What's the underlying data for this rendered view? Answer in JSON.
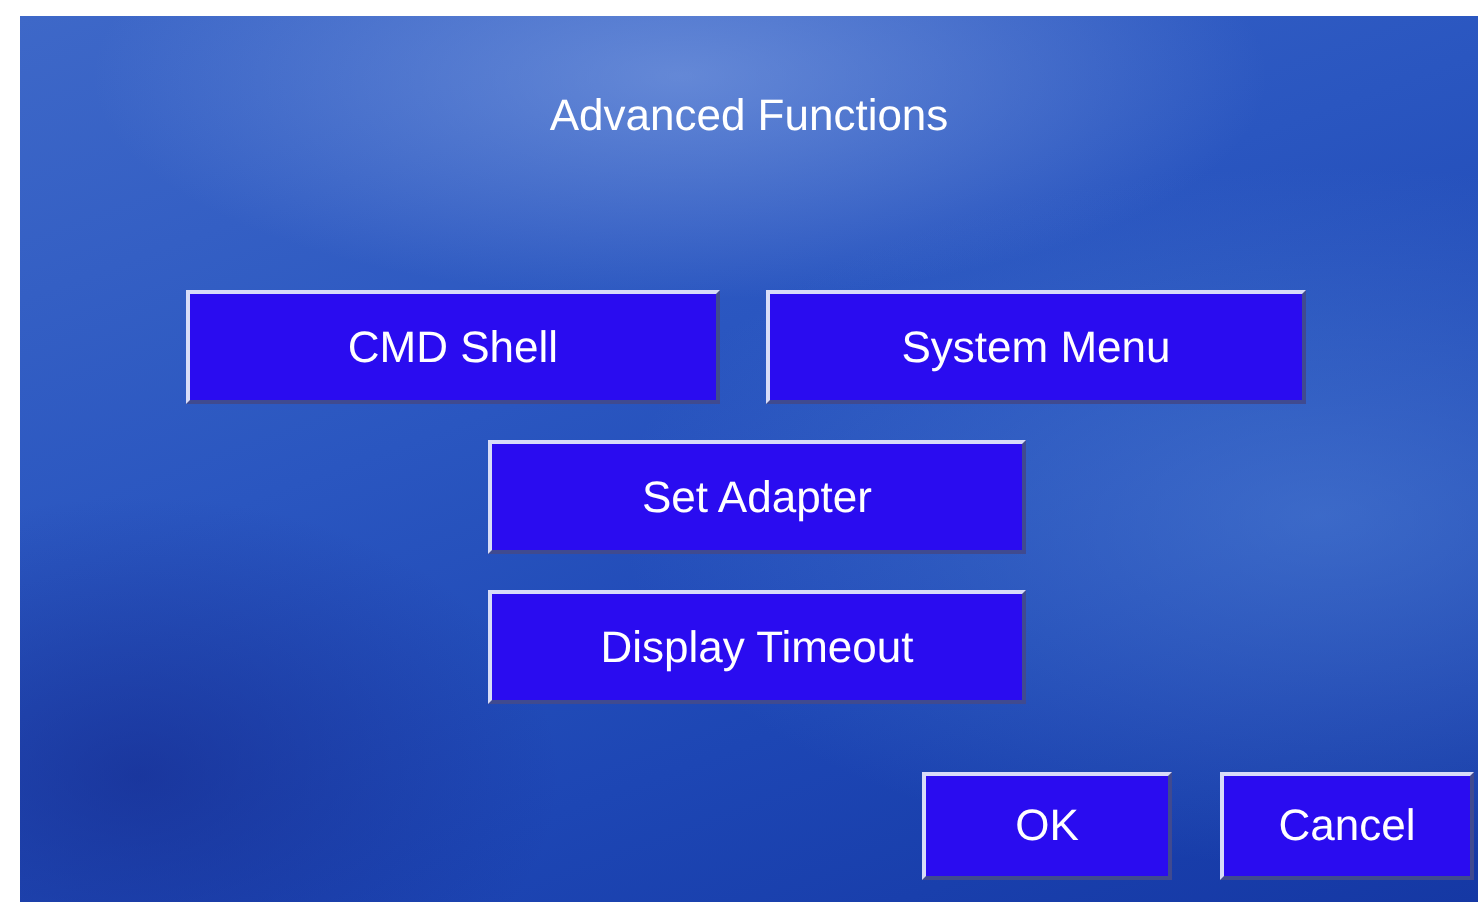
{
  "title": "Advanced Functions",
  "function_rows": [
    [
      {
        "label": "CMD Shell"
      },
      {
        "label": "System Menu"
      }
    ],
    [
      {
        "label": "Set Adapter"
      }
    ],
    [
      {
        "label": "Display Timeout"
      }
    ]
  ],
  "dialog_buttons": [
    {
      "label": "OK"
    },
    {
      "label": "Cancel"
    }
  ]
}
